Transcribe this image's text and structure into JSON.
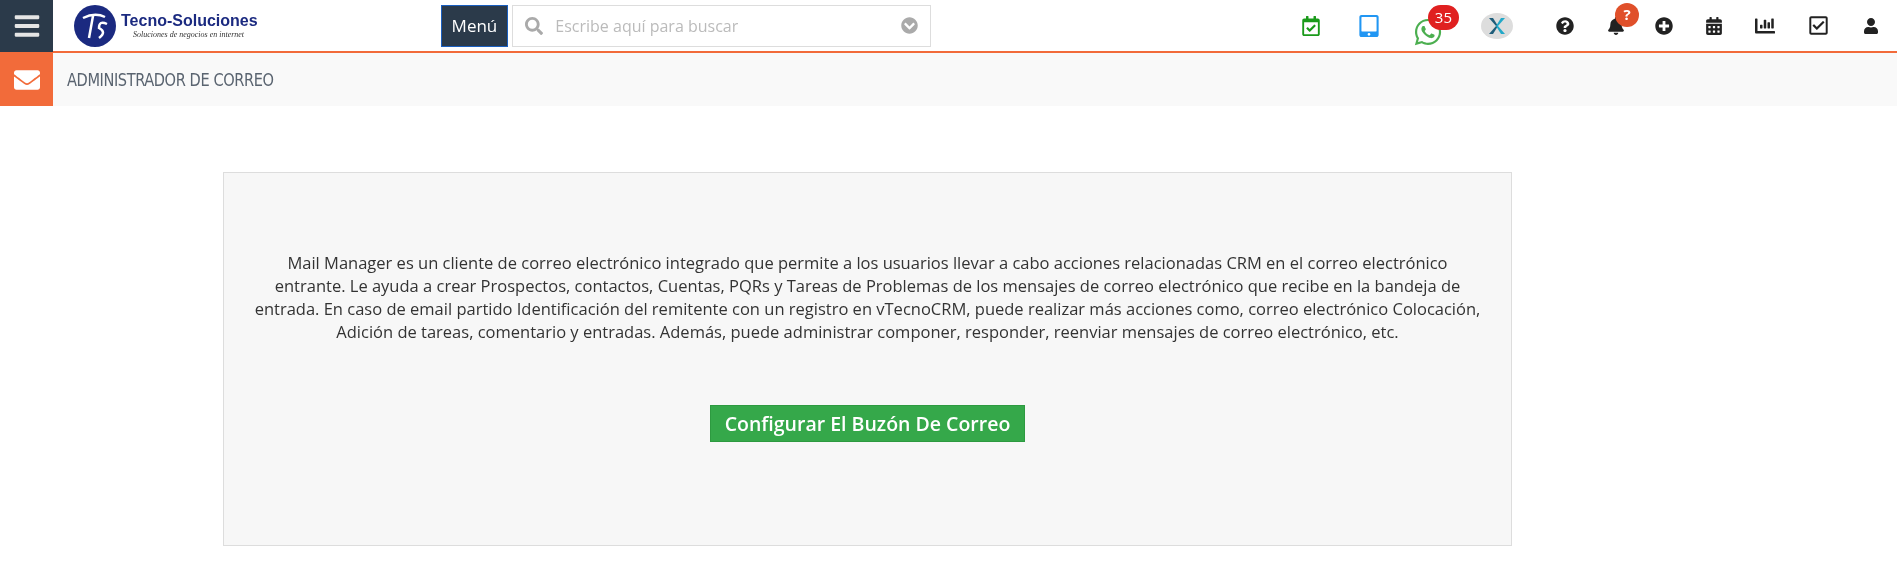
{
  "top_bar": {
    "logo": {
      "name": "Tecno-Soluciones",
      "tagline": "Soluciones de negocios en internet"
    },
    "menu_button": "Menú",
    "search": {
      "placeholder": "Escribe aquí para buscar"
    },
    "chat_badge": "35",
    "notification_badge": "?"
  },
  "page_header": {
    "title": "ADMINISTRADOR DE CORREO"
  },
  "intro": {
    "description": "Mail Manager es un cliente de correo electrónico integrado que permite a los usuarios llevar a cabo acciones relacionadas CRM en el correo electrónico entrante. Le ayuda a crear Prospectos, contactos, Cuentas, PQRs y Tareas de Problemas de los mensajes de correo electrónico que recibe en la bandeja de entrada. En caso de email partido Identificación del remitente con un registro en vTecnoCRM, puede realizar más acciones como, correo electrónico Colocación, Adición de tareas, comentario y entradas. Además, puede administrar componer, responder, reenviar mensajes de correo electrónico, etc.",
    "button": "Configurar El Buzón De Correo"
  }
}
